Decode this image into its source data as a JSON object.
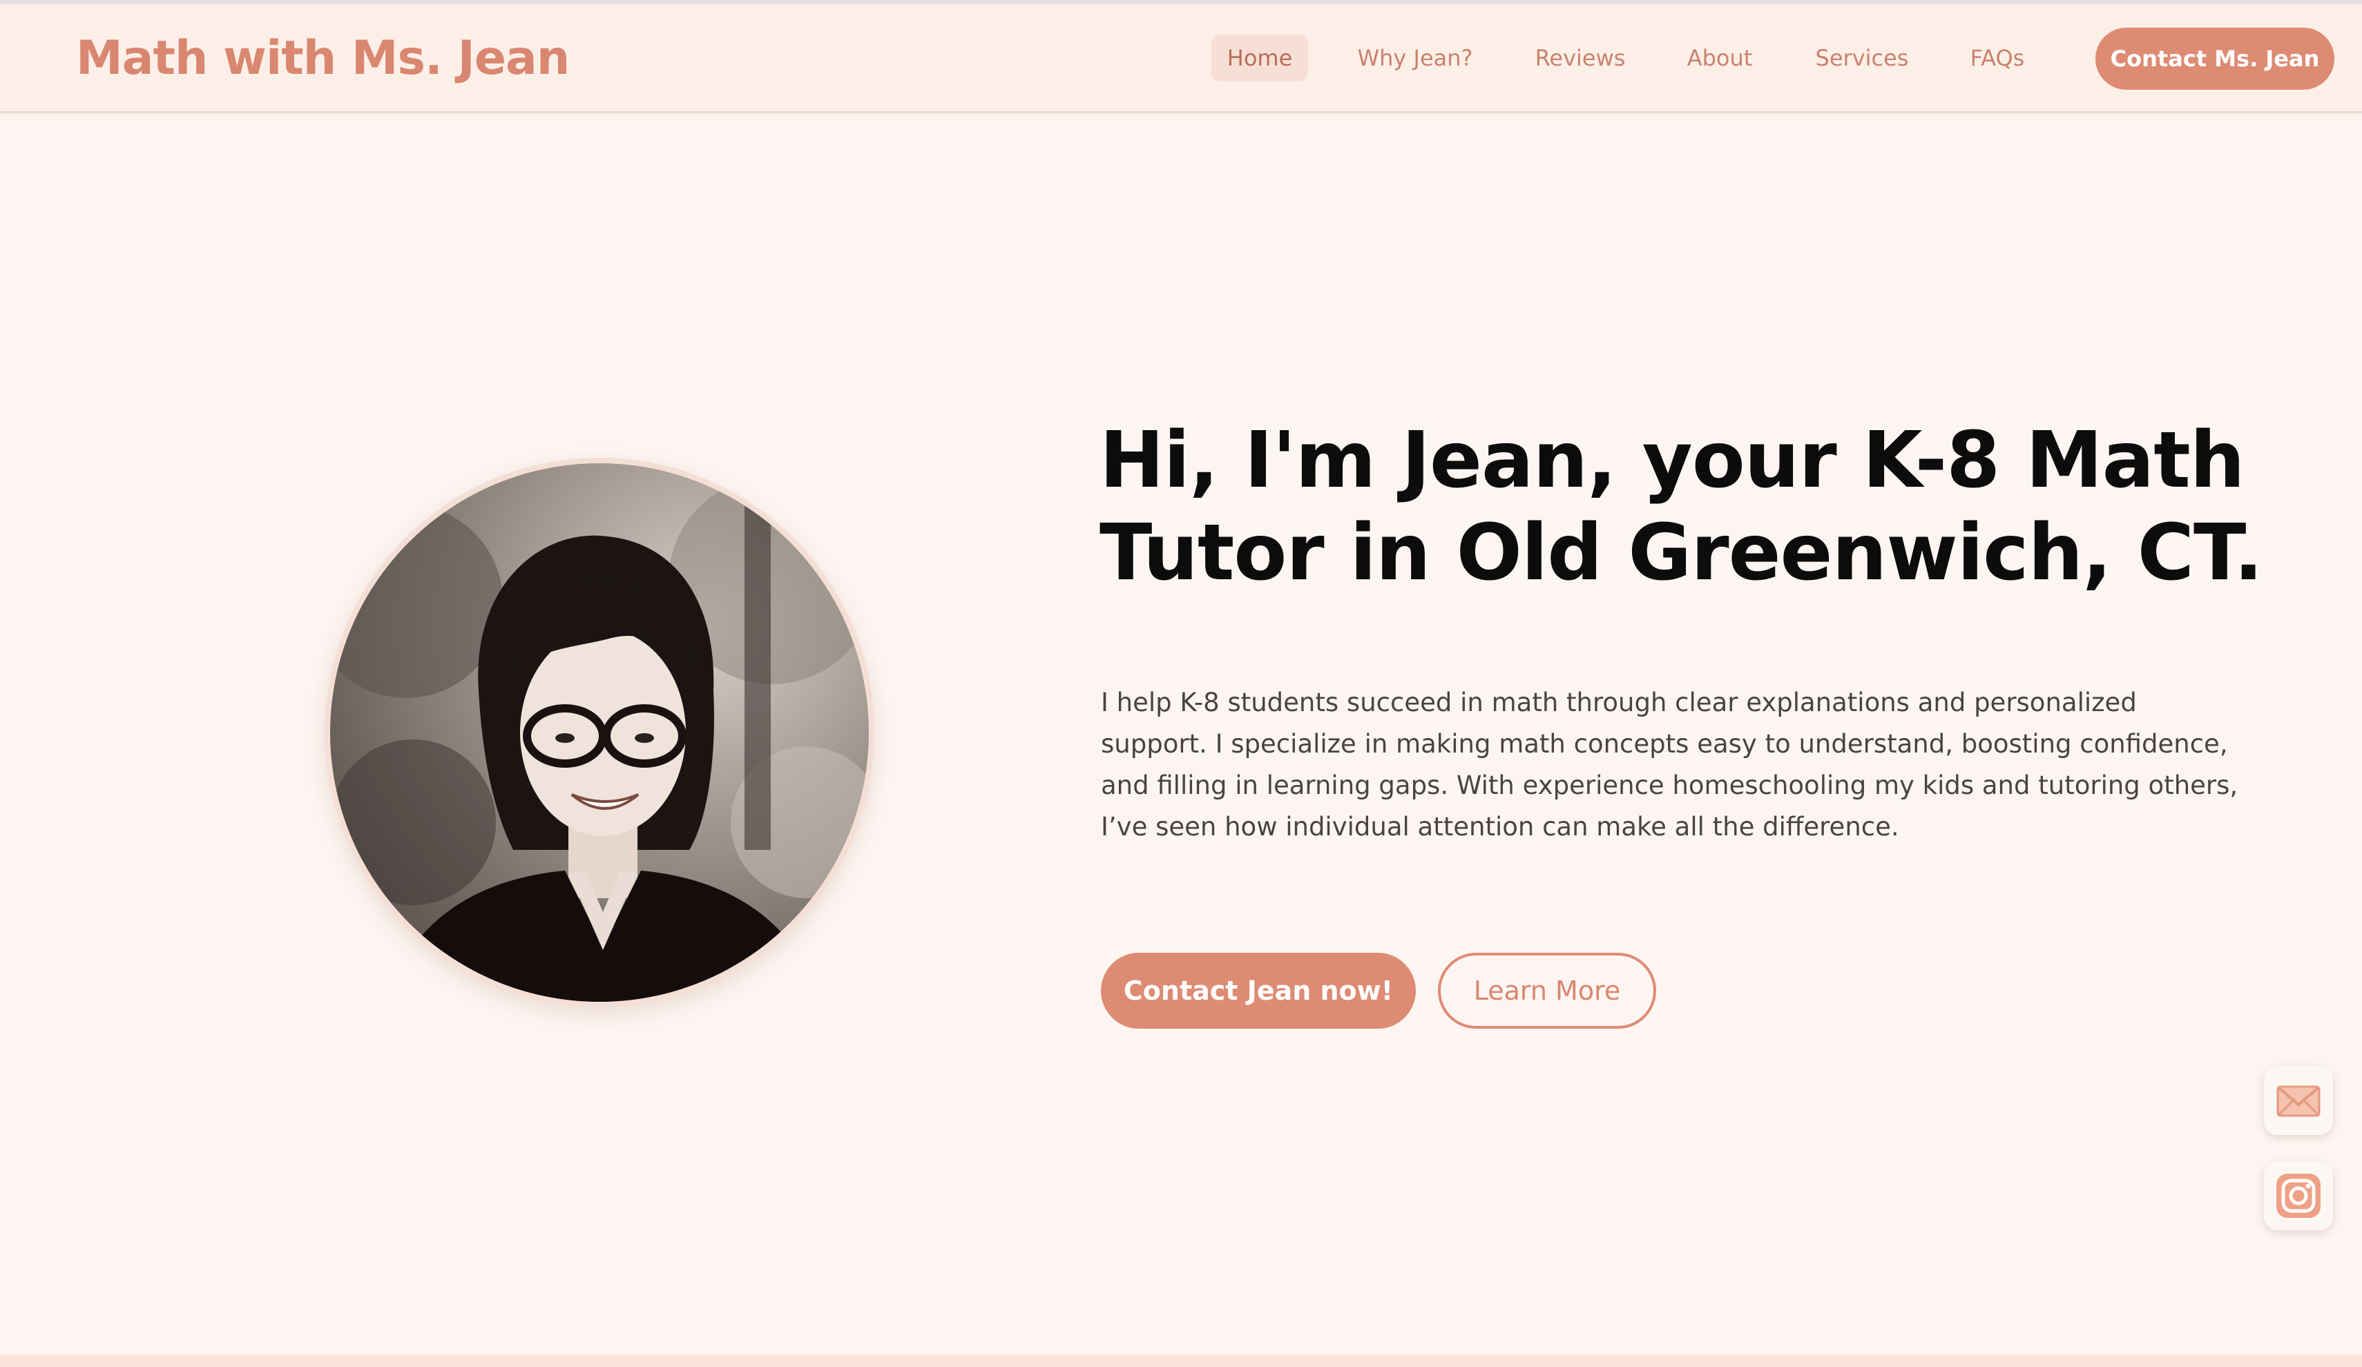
{
  "site": {
    "brand": "Math with Ms. Jean"
  },
  "nav": {
    "items": [
      {
        "label": "Home",
        "active": true
      },
      {
        "label": "Why Jean?",
        "active": false
      },
      {
        "label": "Reviews",
        "active": false
      },
      {
        "label": "About",
        "active": false
      },
      {
        "label": "Services",
        "active": false
      },
      {
        "label": "FAQs",
        "active": false
      }
    ],
    "cta_label": "Contact Ms. Jean"
  },
  "hero": {
    "title_lines": [
      "Hi, I'm Jean, your K-8 Math",
      "Tutor in Old Greenwich, CT."
    ],
    "body_lines": [
      "I help K-8 students succeed in math through clear explanations and personalized",
      "support. I specialize in making math concepts easy to understand, boosting confidence,",
      "and filling in learning gaps. With experience homeschooling my kids and tutoring others,",
      "I’ve seen how individual attention can make all the difference."
    ],
    "primary_button": "Contact Jean now!",
    "secondary_button": "Learn More",
    "portrait_icon": "portrait-photo"
  },
  "floating": {
    "email_icon": "envelope-icon",
    "instagram_icon": "instagram-icon"
  },
  "colors": {
    "accent": "#de8b74",
    "brand_text": "#d98770",
    "header_bg": "#fcefe7",
    "page_bg": "#fdf5f2",
    "nav_active_bg": "#f6e0d6",
    "title_text": "#0c0c0c",
    "body_text": "#4a4340"
  }
}
